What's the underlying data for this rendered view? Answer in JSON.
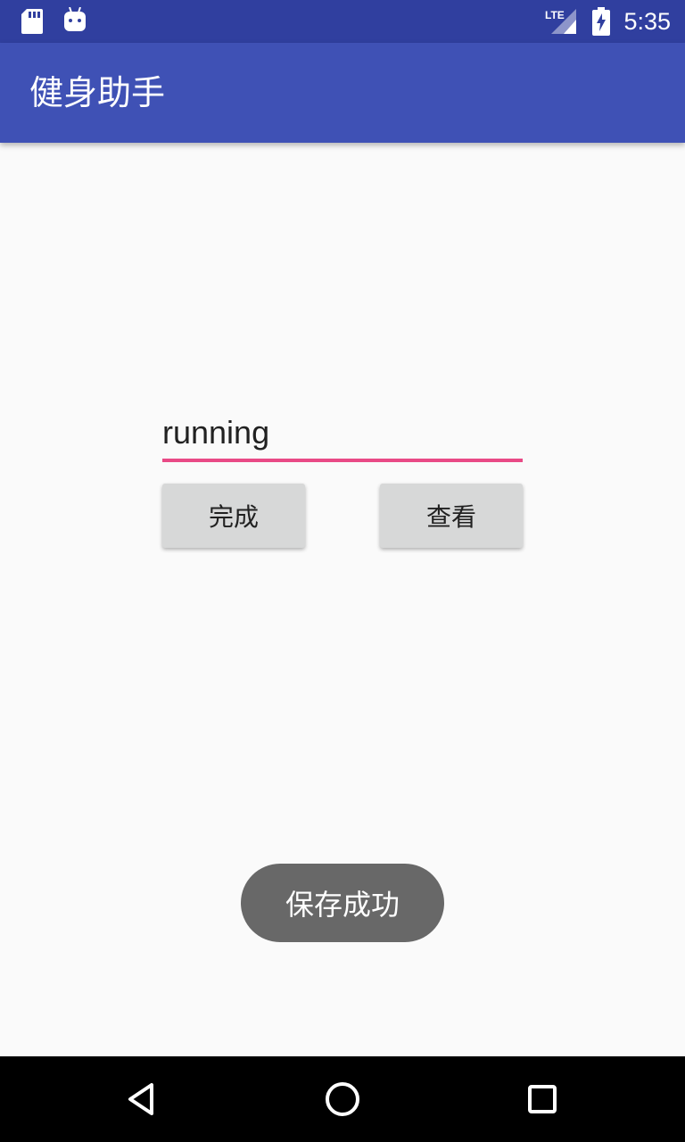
{
  "status_bar": {
    "time": "5:35",
    "left_icons": [
      "sd-card-icon",
      "android-icon"
    ],
    "right_icons": [
      "lte-signal-icon",
      "battery-charging-icon"
    ],
    "network_label": "LTE"
  },
  "app_bar": {
    "title": "健身助手"
  },
  "form": {
    "input_value": "running",
    "done_button": "完成",
    "view_button": "查看"
  },
  "toast": {
    "message": "保存成功"
  },
  "nav_bar": {
    "icons": [
      "back-icon",
      "home-icon",
      "recents-icon"
    ]
  },
  "colors": {
    "status_bar": "#303f9f",
    "app_bar": "#3f51b5",
    "accent": "#e94a86",
    "button": "#d7d8d8",
    "toast": "#686868"
  }
}
